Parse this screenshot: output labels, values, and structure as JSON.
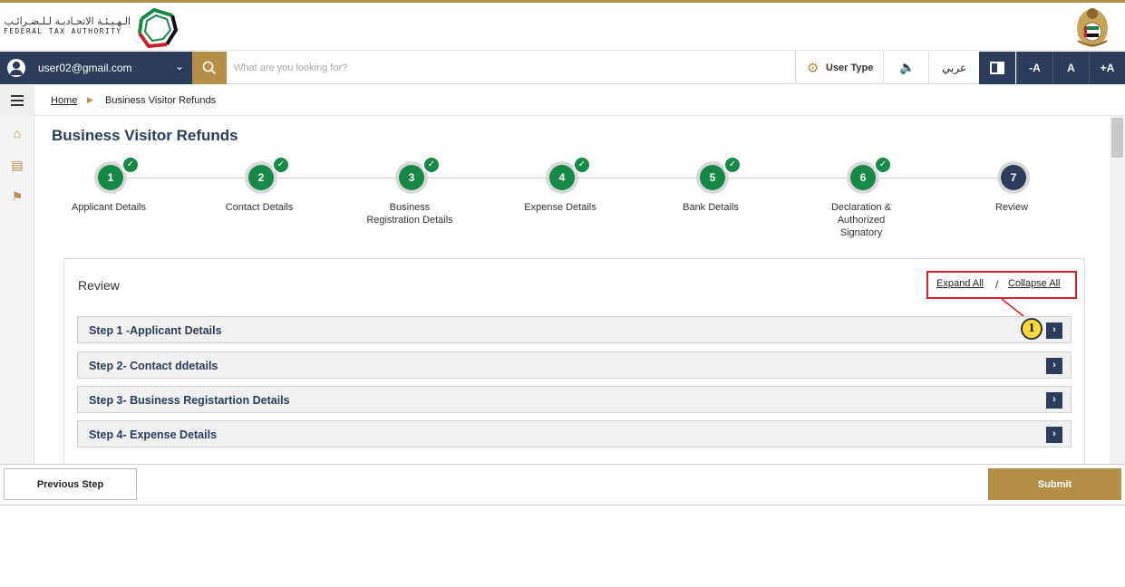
{
  "header": {
    "logo_arabic": "الـهـيـئـة الاتحـاديـة لـلـضـرائـب",
    "logo_english": "FEDERAL TAX AUTHORITY",
    "logo_icon": "fta-logo-icon",
    "emblem_icon": "uae-emblem-icon"
  },
  "navbar": {
    "user_email": "user02@gmail.com",
    "search_placeholder": "What are you looking for?",
    "user_type_label": "User Type",
    "speaker_glyph": "🔈",
    "arabic_label": "عربي",
    "font_decrease": "-A",
    "font_normal": "A",
    "font_increase": "+A"
  },
  "breadcrumb": {
    "home": "Home",
    "current": "Business Visitor Refunds"
  },
  "page": {
    "title": "Business Visitor Refunds"
  },
  "steps": [
    {
      "num": "1",
      "label": "Applicant Details",
      "done": true
    },
    {
      "num": "2",
      "label": "Contact Details",
      "done": true
    },
    {
      "num": "3",
      "label": "Business Registration Details",
      "done": true
    },
    {
      "num": "4",
      "label": "Expense Details",
      "done": true
    },
    {
      "num": "5",
      "label": "Bank Details",
      "done": true
    },
    {
      "num": "6",
      "label": "Declaration & Authorized Signatory",
      "done": true
    },
    {
      "num": "7",
      "label": "Review",
      "done": false
    }
  ],
  "review": {
    "title": "Review",
    "expand_all": "Expand All",
    "separator": "/",
    "collapse_all": "Collapse All",
    "callout_number": "1",
    "sections": [
      "Step 1 -Applicant Details",
      "Step 2- Contact ddetails",
      "Step 3- Business Registartion Details",
      "Step 4- Expense Details"
    ]
  },
  "footer": {
    "previous": "Previous Step",
    "submit": "Submit"
  },
  "colors": {
    "navy": "#2b3d5a",
    "gold": "#b58f47",
    "green": "#178845",
    "highlight_red": "#d9222a"
  }
}
